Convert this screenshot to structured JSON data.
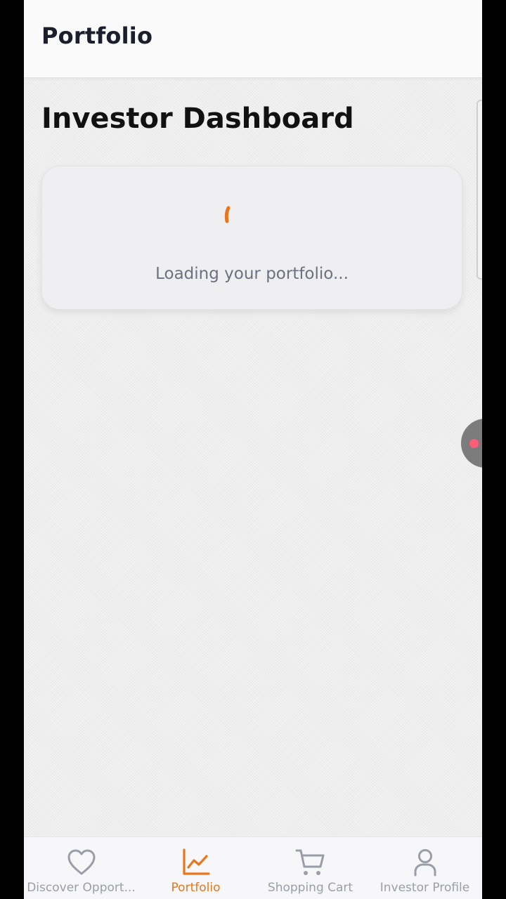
{
  "app_bar": {
    "title": "Portfolio"
  },
  "main": {
    "heading": "Investor Dashboard",
    "loading_card": {
      "message": "Loading your portfolio..."
    }
  },
  "bottom_nav": {
    "items": [
      {
        "label": "Discover Opport...",
        "icon": "heart-icon",
        "active": false
      },
      {
        "label": "Portfolio",
        "icon": "chart-line-icon",
        "active": true
      },
      {
        "label": "Shopping Cart",
        "icon": "cart-icon",
        "active": false
      },
      {
        "label": "Investor Profile",
        "icon": "user-icon",
        "active": false
      }
    ]
  },
  "colors": {
    "accent": "#e8761c",
    "inactive": "#9a9ea8",
    "text_primary": "#111111",
    "text_secondary": "#6b7180",
    "assistive_dot": "#ff5c78"
  }
}
